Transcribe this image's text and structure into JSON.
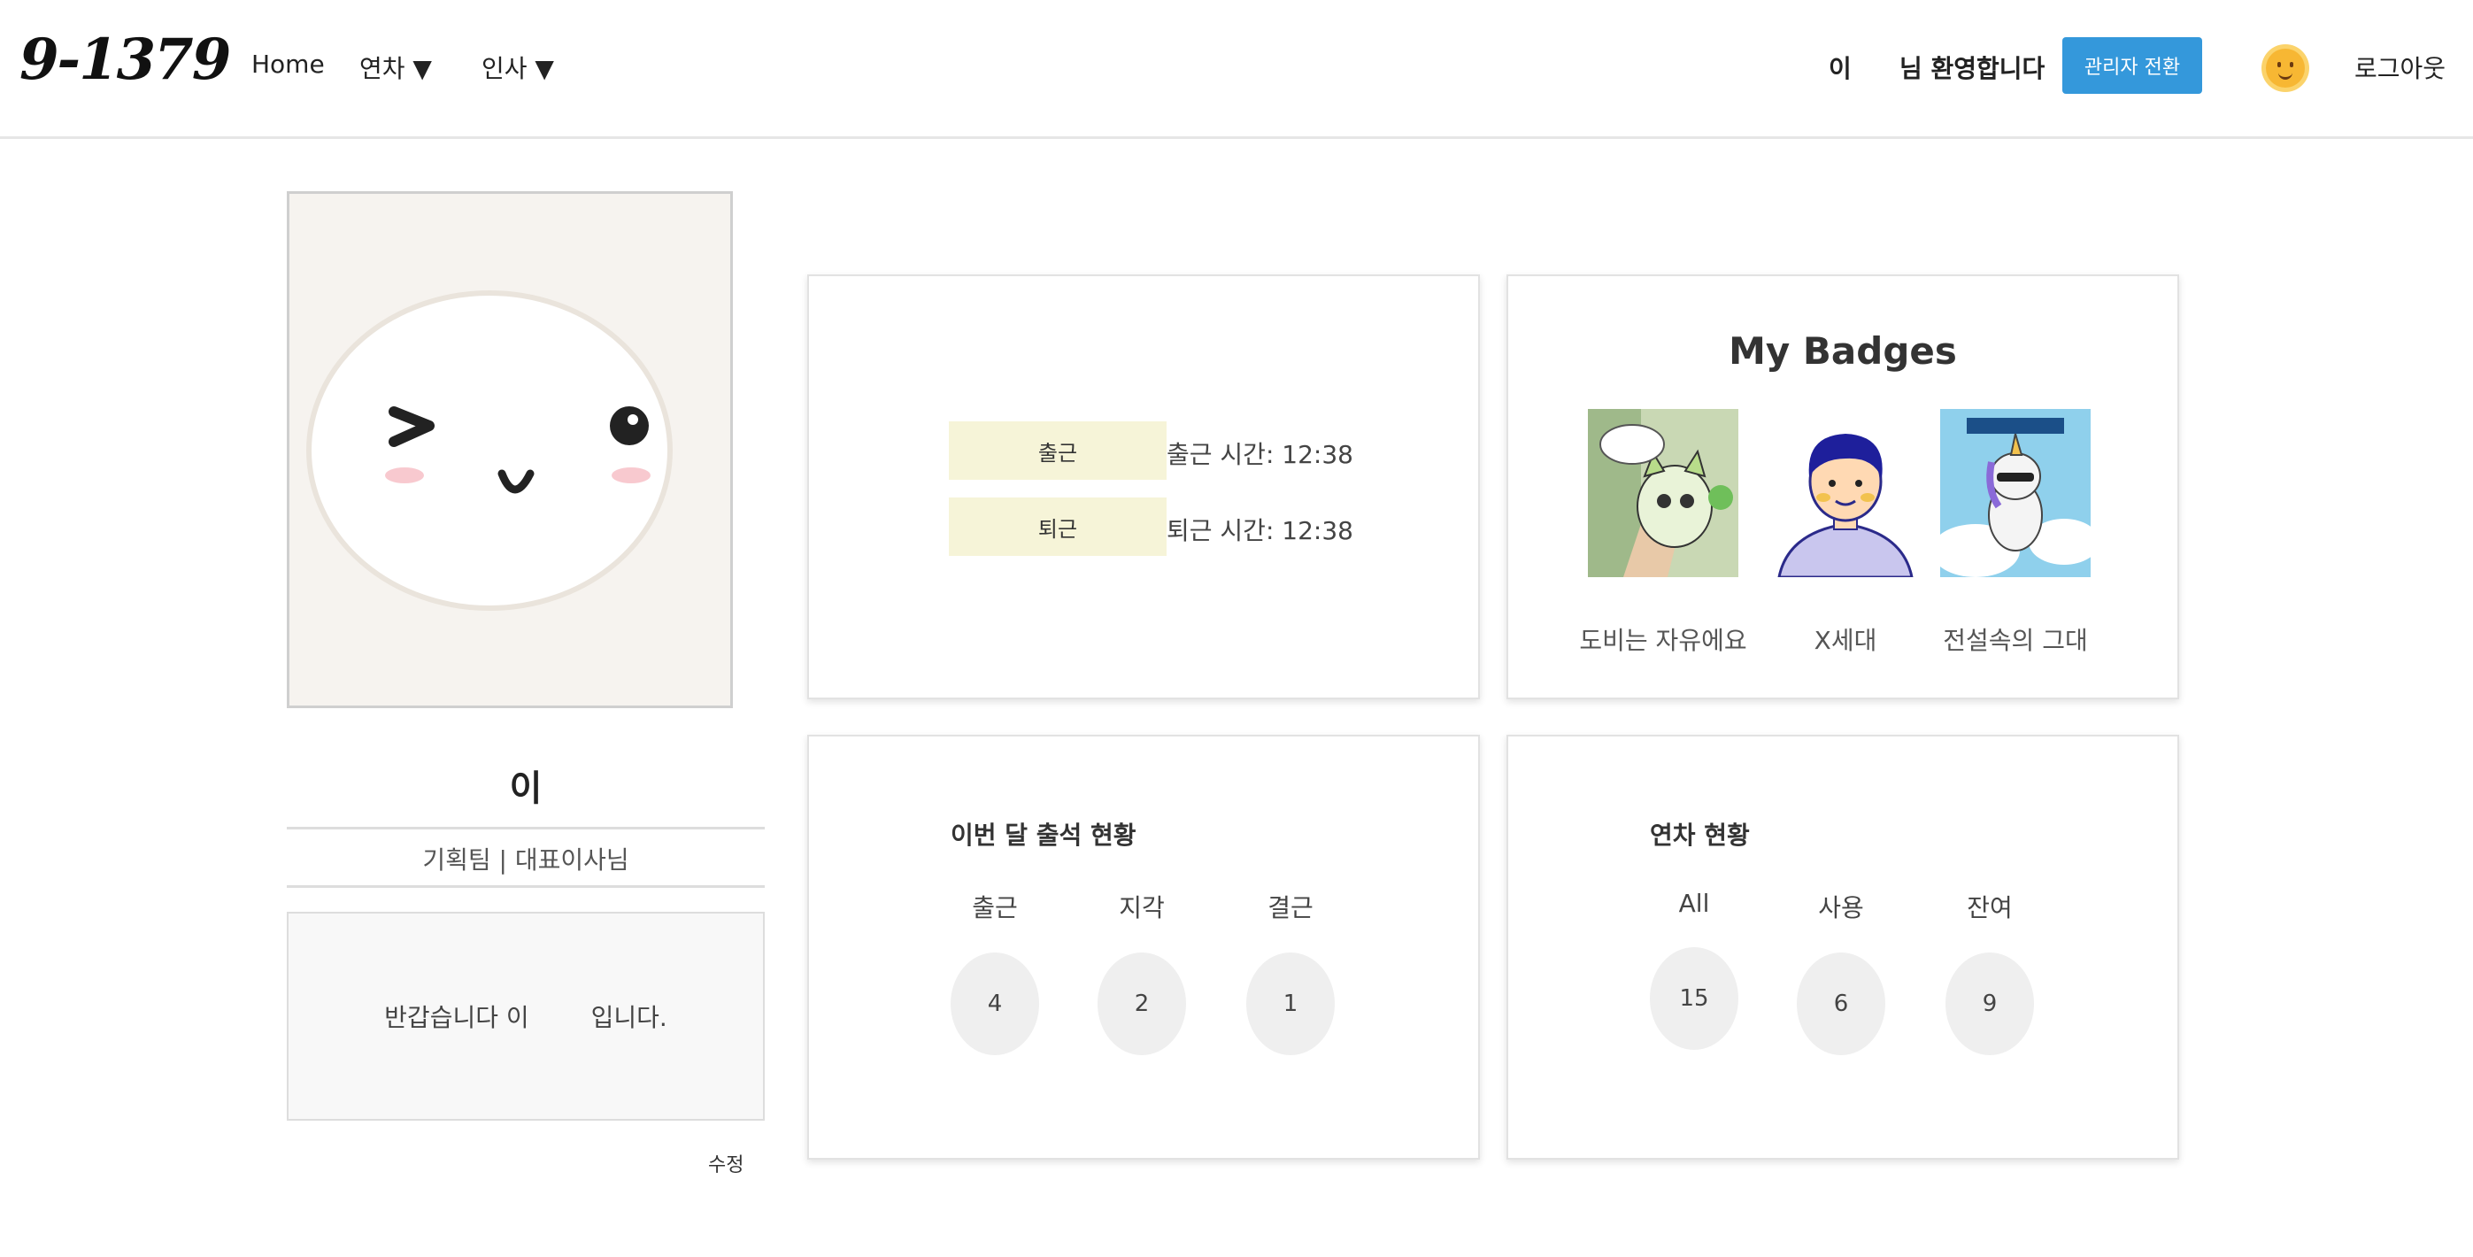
{
  "header": {
    "logo": "9-1379",
    "nav": [
      "Home",
      "연차 ▼",
      "인사 ▼"
    ],
    "user_name": "이",
    "welcome": "님 환영합니다",
    "admin_button": "관리자 전환",
    "logout": "로그아웃",
    "accent_color": "#3498db"
  },
  "profile": {
    "name": "이",
    "department": "기획팀 | 대표이사님",
    "greeting_prefix": "반갑습니다 이",
    "greeting_suffix": "입니다.",
    "edit_label": "수정"
  },
  "attendance_card": {
    "check_in_button": "출근",
    "check_in_time": "출근 시간: 12:38",
    "check_out_button": "퇴근",
    "check_out_time": "퇴근 시간: 12:38"
  },
  "badges": {
    "title": "My Badges",
    "items": [
      {
        "label": "도비는 자유에요",
        "icon": "cat-plant-icon"
      },
      {
        "label": "X세대",
        "icon": "man-portrait-icon"
      },
      {
        "label": "전설속의 그대",
        "icon": "unicorn-icon"
      }
    ]
  },
  "monthly_attendance": {
    "title": "이번 달 출석 현황",
    "stats": [
      {
        "label": "출근",
        "value": "4"
      },
      {
        "label": "지각",
        "value": "2"
      },
      {
        "label": "결근",
        "value": "1"
      }
    ]
  },
  "annual_leave": {
    "title": "연차 현황",
    "stats": [
      {
        "label": "All",
        "value": "15"
      },
      {
        "label": "사용",
        "value": "6"
      },
      {
        "label": "잔여",
        "value": "9"
      }
    ]
  }
}
